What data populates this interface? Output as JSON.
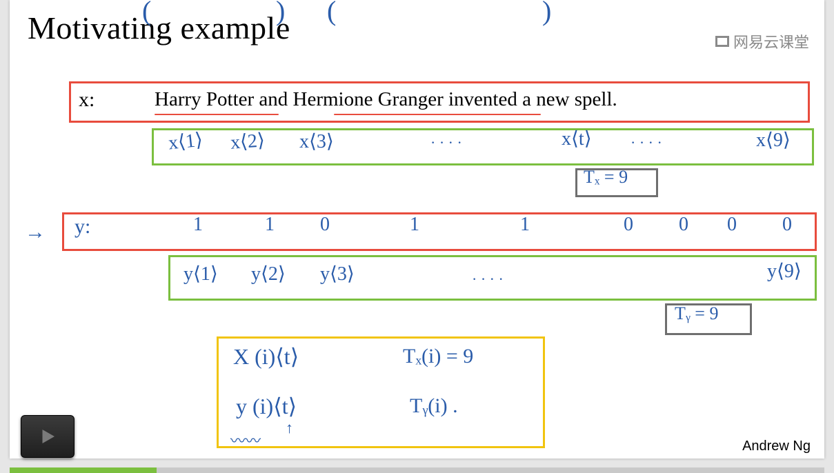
{
  "title": "Motivating example",
  "watermark": "网易云课堂",
  "author": "Andrew Ng",
  "x_label": "x:",
  "sentence": "Harry Potter and Hermione Granger invented a new spell.",
  "x_tokens": {
    "x1": "x⟨1⟩",
    "x2": "x⟨2⟩",
    "x3": "x⟨3⟩",
    "dots1": "· · · ·",
    "xt": "x⟨t⟩",
    "dots2": "· · · ·",
    "x9": "x⟨9⟩"
  },
  "Tx": "Tₓ = 9",
  "y_label": "y:",
  "arrow": "→",
  "y_vals": {
    "v1": "1",
    "v2": "1",
    "v3": "0",
    "v4": "1",
    "v5": "1",
    "v6": "0",
    "v7": "0",
    "v8": "0",
    "v9": "0"
  },
  "y_tokens": {
    "y1": "y⟨1⟩",
    "y2": "y⟨2⟩",
    "y3": "y⟨3⟩",
    "dots": "· · · ·",
    "y9": "y⟨9⟩"
  },
  "Ty": "Tᵧ = 9",
  "notation": {
    "xit": "X (i)⟨t⟩",
    "yit": "y (i)⟨t⟩",
    "txi": "Tₓ(i) = 9",
    "tyi": "Tᵧ(i) .",
    "uparrow": "↑",
    "squiggle": "〰〰"
  },
  "icons": {
    "play": "play-icon",
    "watermark": "book-icon"
  }
}
